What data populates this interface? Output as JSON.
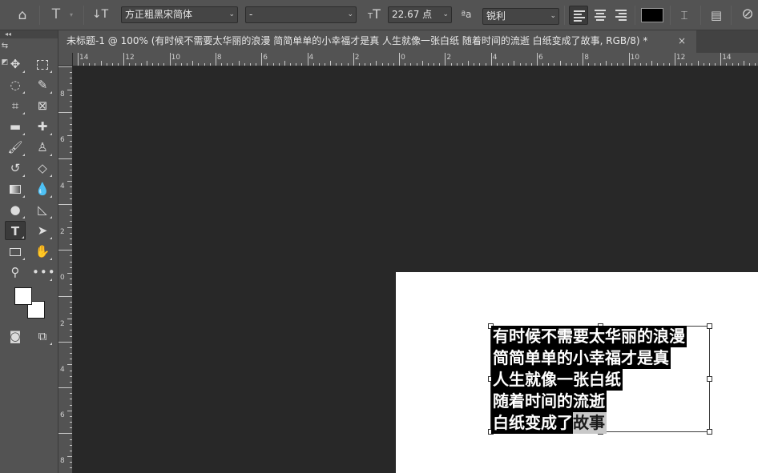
{
  "options_bar": {
    "font_family": "方正粗黑宋简体",
    "font_style": "-",
    "font_size": "22.67 点",
    "antialias_label": "ªa",
    "antialias_value": "锐利",
    "text_color": "#000000"
  },
  "tab": {
    "title": "未标题-1 @ 100% (有时候不需要太华丽的浪漫 简简单单的小幸福才是真 人生就像一张白纸 随着时间的流逝 白纸变成了故事, RGB/8) *",
    "close": "×"
  },
  "ruler_top": [
    "14",
    "12",
    "10",
    "8",
    "6",
    "4",
    "2",
    "0",
    "2",
    "4",
    "6",
    "8",
    "10",
    "12",
    "14"
  ],
  "ruler_left": [
    "8",
    "6",
    "4",
    "2",
    "0",
    "2",
    "4",
    "6",
    "8"
  ],
  "text_layer": {
    "lines": [
      {
        "text": "有时候不需要太华丽的浪漫",
        "selected_tail": ""
      },
      {
        "text": "简简单单的小幸福才是真",
        "selected_tail": ""
      },
      {
        "text": "人生就像一张白纸",
        "selected_tail": ""
      },
      {
        "text": "随着时间的流逝",
        "selected_tail": ""
      },
      {
        "text": "白纸变成了",
        "selected_tail": "故事"
      }
    ]
  },
  "colors": {
    "foreground": "#ffffff",
    "background": "#ffffff",
    "panel": "#535353",
    "canvas": "#282828"
  },
  "icons": {
    "home": "⌂",
    "type_tool": "T",
    "orient": "↓T",
    "size": "T",
    "warp": "T",
    "panels": "☰",
    "cancel": "⊘"
  }
}
